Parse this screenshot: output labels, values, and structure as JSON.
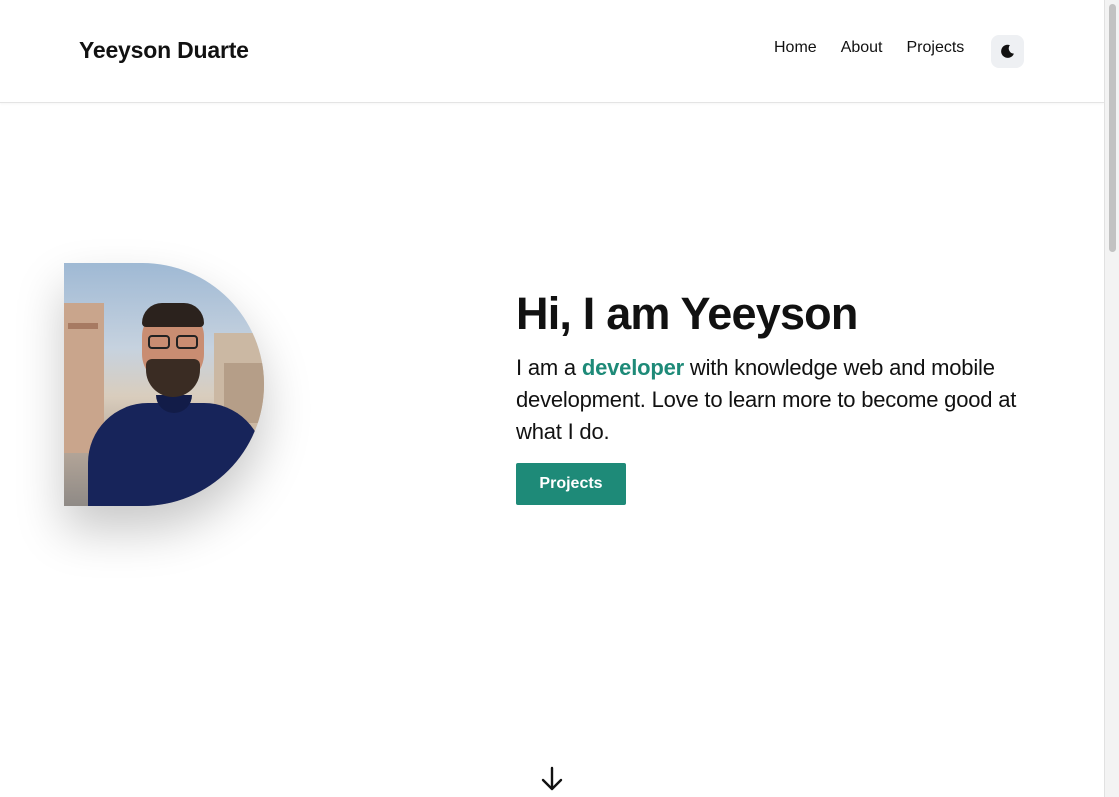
{
  "header": {
    "brand": "Yeeyson Duarte",
    "nav": [
      {
        "label": "Home"
      },
      {
        "label": "About"
      },
      {
        "label": "Projects"
      }
    ],
    "theme_toggle_icon": "moon-icon"
  },
  "hero": {
    "title": "Hi, I am Yeeyson",
    "description_prefix": "I am a ",
    "description_highlight": "developer",
    "description_suffix": " with knowledge web and mobile development. Love to learn more to become good at what I do.",
    "cta_label": "Projects",
    "accent_color": "#1e8a78"
  },
  "scroll_indicator_icon": "arrow-down-icon"
}
